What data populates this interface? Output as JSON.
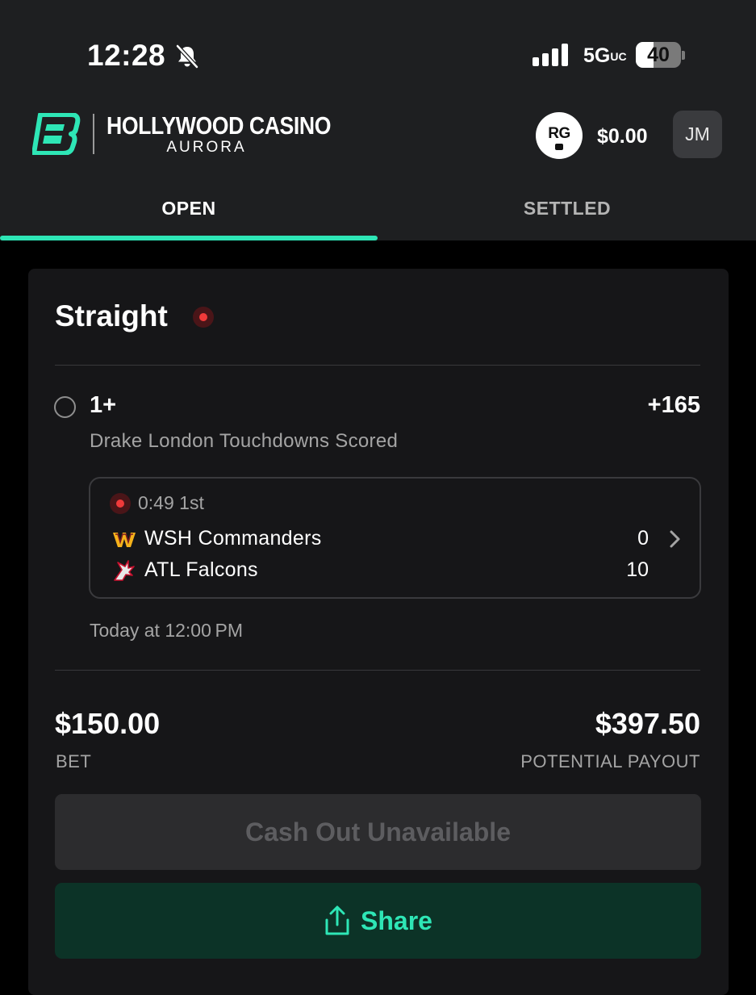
{
  "status_bar": {
    "time": "12:28",
    "network": "5G",
    "network_sup": "UC",
    "battery": "40",
    "battery_level": 0.4
  },
  "header": {
    "brand_name": "HOLLYWOOD CASINO",
    "brand_location": "AURORA",
    "rg_label": "RG",
    "balance": "$0.00",
    "avatar_initials": "JM"
  },
  "tabs": [
    {
      "label": "OPEN",
      "active": true
    },
    {
      "label": "SETTLED",
      "active": false
    }
  ],
  "bet": {
    "type": "Straight",
    "selection": "1+",
    "odds": "+165",
    "market": "Drake London Touchdowns Scored",
    "game": {
      "clock": "0:49 1st",
      "teams": [
        {
          "name": "WSH Commanders",
          "score": "0",
          "icon": "commanders-logo-icon"
        },
        {
          "name": "ATL Falcons",
          "score": "10",
          "icon": "falcons-logo-icon"
        }
      ]
    },
    "start_time": "Today at 12:00 PM",
    "stake": "$150.00",
    "stake_label": "BET",
    "payout": "$397.50",
    "payout_label": "POTENTIAL PAYOUT",
    "cashout_label": "Cash Out Unavailable",
    "share_label": "Share"
  },
  "colors": {
    "accent": "#2ee6b6",
    "live": "#f03a3a",
    "header_bg": "#1e1f21",
    "card_bg": "#161618",
    "share_bg": "#0c3327"
  }
}
